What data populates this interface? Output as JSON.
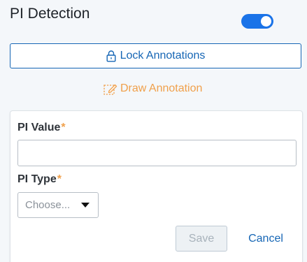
{
  "header": {
    "title": "PI Detection",
    "toggle_on": true
  },
  "actions": {
    "lock_label": "Lock Annotations",
    "lock_icon": "lock-icon",
    "draw_label": "Draw Annotation",
    "draw_icon": "draw-annotation-icon"
  },
  "form": {
    "pi_value": {
      "label": "PI Value",
      "required_mark": "*",
      "value": "",
      "placeholder": ""
    },
    "pi_type": {
      "label": "PI Type",
      "required_mark": "*",
      "selected": "Choose..."
    },
    "save_label": "Save",
    "cancel_label": "Cancel"
  },
  "colors": {
    "primary": "#1666b5",
    "toggle": "#1a73e8",
    "accent": "#f0a04b",
    "background": "#f4f7fa"
  }
}
